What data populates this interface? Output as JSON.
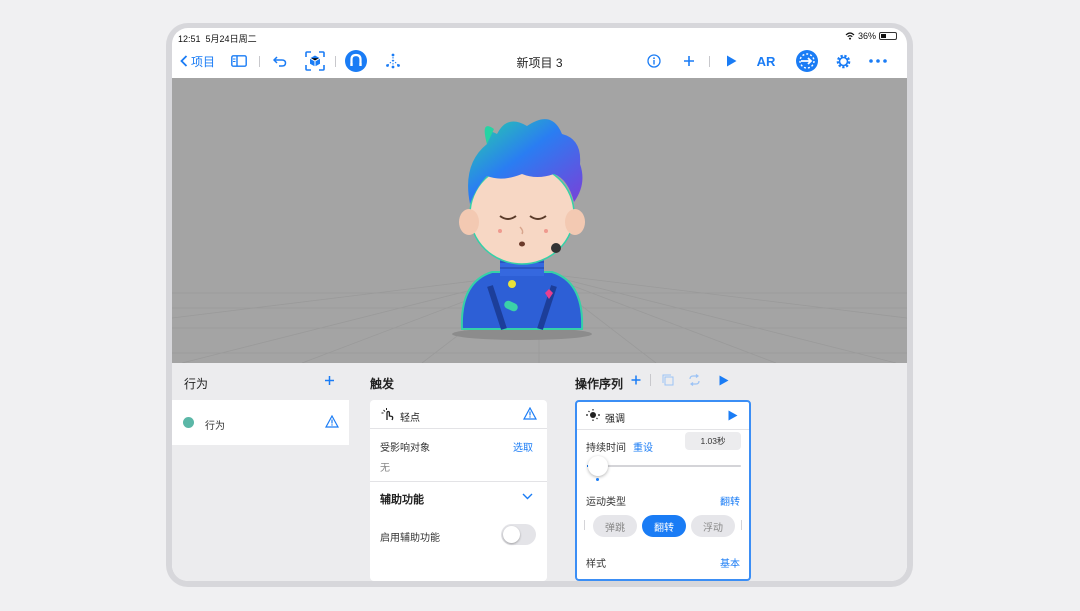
{
  "status": {
    "time": "12:51",
    "date": "5月24日周二",
    "battery": "36%"
  },
  "toolbar": {
    "back_label": "项目",
    "title": "新项目 3",
    "ar_label": "AR"
  },
  "behaviors": {
    "header": "行为",
    "item_label": "行为",
    "item_color": "#5bb7a7"
  },
  "trigger": {
    "header": "触发",
    "card_title": "轻点",
    "affected_label": "受影响对象",
    "affected_action": "选取",
    "affected_value": "无",
    "accessibility_header": "辅助功能",
    "enable_accessibility_label": "启用辅助功能"
  },
  "sequence": {
    "header": "操作序列",
    "card_title": "强调",
    "duration_label": "持续时间",
    "duration_reset": "重设",
    "duration_value": "1.03秒",
    "motion_label": "运动类型",
    "motion_value": "翻转",
    "options": [
      "弹跳",
      "翻转",
      "浮动"
    ],
    "style_label": "样式",
    "style_value": "基本"
  },
  "colors": {
    "accent": "#1a7cf5",
    "warning": "#1a7cf5"
  }
}
